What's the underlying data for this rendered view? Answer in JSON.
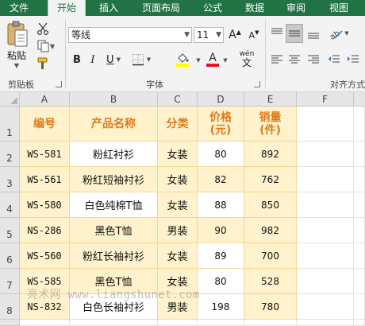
{
  "tabs": [
    {
      "label": "文件",
      "active": false
    },
    {
      "label": "开始",
      "active": true
    },
    {
      "label": "插入",
      "active": false
    },
    {
      "label": "页面布局",
      "active": false
    },
    {
      "label": "公式",
      "active": false
    },
    {
      "label": "数据",
      "active": false
    },
    {
      "label": "审阅",
      "active": false
    },
    {
      "label": "视图",
      "active": false
    }
  ],
  "ribbon": {
    "clipboard": {
      "paste_label": "粘贴",
      "group_label": "剪贴板"
    },
    "font": {
      "font_name": "等线",
      "font_size": "11",
      "group_label": "字体",
      "bold": "B",
      "italic": "I",
      "underline": "U",
      "phonetic_glyph": "wén",
      "grow": "A",
      "shrink": "A"
    },
    "alignment": {
      "group_label": "对齐方式"
    }
  },
  "sheet": {
    "columns": [
      "A",
      "B",
      "C",
      "D",
      "E",
      "F"
    ],
    "row_numbers": [
      "1",
      "2",
      "3",
      "4",
      "5",
      "6",
      "7",
      "8"
    ],
    "headers": [
      "编号",
      "产品名称",
      "分类",
      "价格\n(元)",
      "销量\n(件)"
    ],
    "rows": [
      [
        "WS-581",
        "粉红衬衫",
        "女装",
        "80",
        "892"
      ],
      [
        "WS-561",
        "粉红短袖衬衫",
        "女装",
        "82",
        "762"
      ],
      [
        "WS-580",
        "白色纯棉T恤",
        "女装",
        "88",
        "850"
      ],
      [
        "NS-286",
        "黑色T恤",
        "男装",
        "90",
        "982"
      ],
      [
        "WS-560",
        "粉红长袖衬衫",
        "女装",
        "89",
        "700"
      ],
      [
        "WS-585",
        "黑色T恤",
        "女装",
        "80",
        "528"
      ],
      [
        "NS-832",
        "白色长袖衬衫",
        "男装",
        "198",
        "780"
      ]
    ],
    "watermark": "亮术网 www.liangshunet.com"
  },
  "colors": {
    "excel_green": "#217346",
    "header_text": "#e07a1a",
    "cell_fill": "#fff2cc",
    "cell_border": "#f2d891",
    "font_color_bar": "#e81123",
    "fill_color_bar": "#ffff00"
  }
}
